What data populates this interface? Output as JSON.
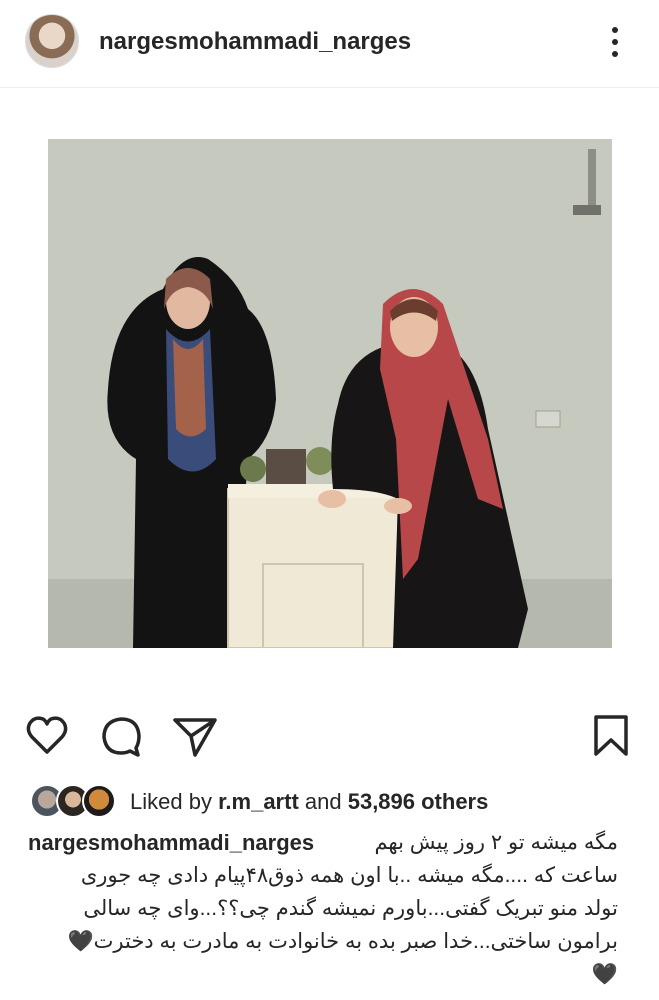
{
  "header": {
    "username": "nargesmohammadi_narges",
    "more_icon": "more-vertical-icon"
  },
  "post": {
    "image_alt": "two women standing beside a small white cabinet"
  },
  "actions": {
    "like_icon": "heart-icon",
    "comment_icon": "comment-icon",
    "share_icon": "send-icon",
    "save_icon": "bookmark-icon"
  },
  "likes": {
    "prefix": "Liked by ",
    "user": "r.m_artt",
    "middle": " and ",
    "count": "53,896 others"
  },
  "caption": {
    "username": "nargesmohammadi_narges",
    "line1": "مگه میشه تو ۲ روز پیش بهم",
    "line2": "ساعت که ....مگه میشه ..با اون همه ذوق۴۸پیام دادی چه جوری",
    "line3": "تولد منو تبریک گفتی...باورم نمیشه گندم چی؟؟...وای چه سالی",
    "line4": "برامون ساختی...خدا صبر بده به خانوادت به مادرت به دخترت🖤",
    "line5": "🖤"
  }
}
